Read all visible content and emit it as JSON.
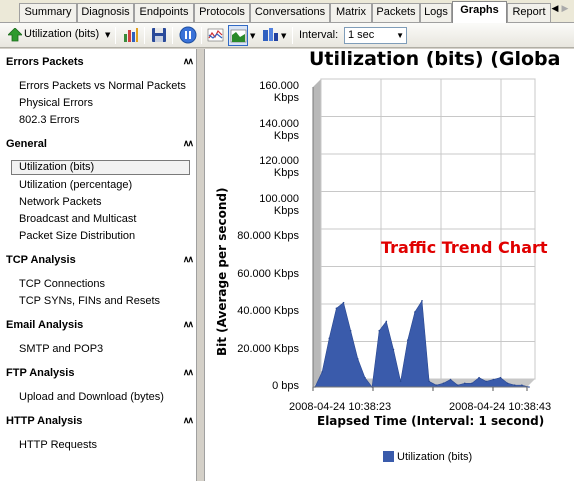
{
  "tabs": [
    {
      "label": "Summary"
    },
    {
      "label": "Diagnosis"
    },
    {
      "label": "Endpoints"
    },
    {
      "label": "Protocols"
    },
    {
      "label": "Conversations"
    },
    {
      "label": "Matrix"
    },
    {
      "label": "Packets"
    },
    {
      "label": "Logs"
    },
    {
      "label": "Graphs",
      "active": true
    },
    {
      "label": "Report"
    }
  ],
  "toolbar": {
    "graph_selector_label": "Utilization (bits)",
    "interval_label": "Interval:",
    "interval_value": "1 sec"
  },
  "sidebar": {
    "sections": [
      {
        "title": "Errors Packets",
        "items": [
          "Errors Packets vs Normal Packets",
          "Physical Errors",
          "802.3 Errors"
        ]
      },
      {
        "title": "General",
        "items": [
          "Utilization (bits)",
          "Utilization (percentage)",
          "Network Packets",
          "Broadcast and Multicast",
          "Packet Size Distribution"
        ],
        "selected": "Utilization (bits)"
      },
      {
        "title": "TCP Analysis",
        "items": [
          "TCP Connections",
          "TCP SYNs, FINs and Resets"
        ]
      },
      {
        "title": "Email Analysis",
        "items": [
          "SMTP and POP3"
        ]
      },
      {
        "title": "FTP Analysis",
        "items": [
          "Upload and Download (bytes)"
        ]
      },
      {
        "title": "HTTP Analysis",
        "items": [
          "HTTP Requests"
        ]
      }
    ]
  },
  "chart_data": {
    "type": "area",
    "title": "Utilization (bits) (Globa",
    "annotation": "Traffic Trend Chart",
    "ylabel": "Bit (Average per second)",
    "xlabel": "Elapsed Time (Interval: 1 second)",
    "ytick_labels": [
      "0 bps",
      "20.000 Kbps",
      "40.000 Kbps",
      "60.000 Kbps",
      "80.000 Kbps",
      "100.000 Kbps",
      "120.000 Kbps",
      "140.000 Kbps",
      "160.000 Kbps"
    ],
    "yticks": [
      0,
      20000,
      40000,
      60000,
      80000,
      100000,
      120000,
      140000,
      160000
    ],
    "ylim": [
      0,
      160000
    ],
    "xtick_labels": [
      "2008-04-24 10:38:23",
      "2008-04-24 10:38:43"
    ],
    "grid": true,
    "legend_position": "bottom",
    "series": [
      {
        "name": "Utilization (bits)",
        "color": "#3a5bab",
        "values": [
          0,
          8000,
          26000,
          42000,
          45000,
          30000,
          15000,
          5000,
          0,
          30000,
          35000,
          20000,
          3000,
          25000,
          40000,
          46000,
          3000,
          1000,
          2000,
          4000,
          1000,
          2000,
          2000,
          5000,
          3000,
          4000,
          5000,
          2000,
          1000,
          1000,
          0
        ]
      }
    ]
  }
}
